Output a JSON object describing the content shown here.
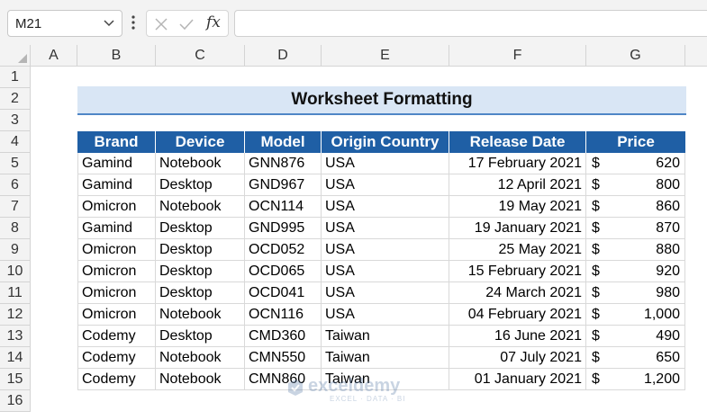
{
  "name_box": {
    "value": "M21"
  },
  "formula_bar": {
    "fx_label": "fx",
    "value": ""
  },
  "columns": [
    "A",
    "B",
    "C",
    "D",
    "E",
    "F",
    "G"
  ],
  "rows": [
    "1",
    "2",
    "3",
    "4",
    "5",
    "6",
    "7",
    "8",
    "9",
    "10",
    "11",
    "12",
    "13",
    "14",
    "15",
    "16"
  ],
  "title": "Worksheet Formatting",
  "table": {
    "headers": [
      "Brand",
      "Device",
      "Model",
      "Origin Country",
      "Release Date",
      "Price"
    ],
    "rows": [
      [
        "Gamind",
        "Notebook",
        "GNN876",
        "USA",
        "17 February 2021",
        "$",
        "620"
      ],
      [
        "Gamind",
        "Desktop",
        "GND967",
        "USA",
        "12 April 2021",
        "$",
        "800"
      ],
      [
        "Omicron",
        "Notebook",
        "OCN114",
        "USA",
        "19 May 2021",
        "$",
        "860"
      ],
      [
        "Gamind",
        "Desktop",
        "GND995",
        "USA",
        "19 January 2021",
        "$",
        "870"
      ],
      [
        "Omicron",
        "Desktop",
        "OCD052",
        "USA",
        "25 May 2021",
        "$",
        "880"
      ],
      [
        "Omicron",
        "Desktop",
        "OCD065",
        "USA",
        "15 February 2021",
        "$",
        "920"
      ],
      [
        "Omicron",
        "Desktop",
        "OCD041",
        "USA",
        "24 March 2021",
        "$",
        "980"
      ],
      [
        "Omicron",
        "Notebook",
        "OCN116",
        "USA",
        "04 February 2021",
        "$",
        "1,000"
      ],
      [
        "Codemy",
        "Desktop",
        "CMD360",
        "Taiwan",
        "16 June 2021",
        "$",
        "490"
      ],
      [
        "Codemy",
        "Notebook",
        "CMN550",
        "Taiwan",
        "07 July 2021",
        "$",
        "650"
      ],
      [
        "Codemy",
        "Notebook",
        "CMN860",
        "Taiwan",
        "01 January 2021",
        "$",
        "1,200"
      ]
    ]
  },
  "watermark": {
    "name": "exceldemy",
    "tagline": "EXCEL · DATA · BI"
  },
  "colors": {
    "header_fill": "#1f5fa5",
    "title_fill": "#d9e6f5",
    "title_underline": "#4f86c6",
    "gridline": "#d9d9d9"
  },
  "icons": {
    "name_box_dropdown": "chevron-down-icon",
    "more": "vertical-dots-icon",
    "cancel": "cancel-x-icon",
    "enter": "checkmark-icon",
    "function": "fx-icon"
  }
}
